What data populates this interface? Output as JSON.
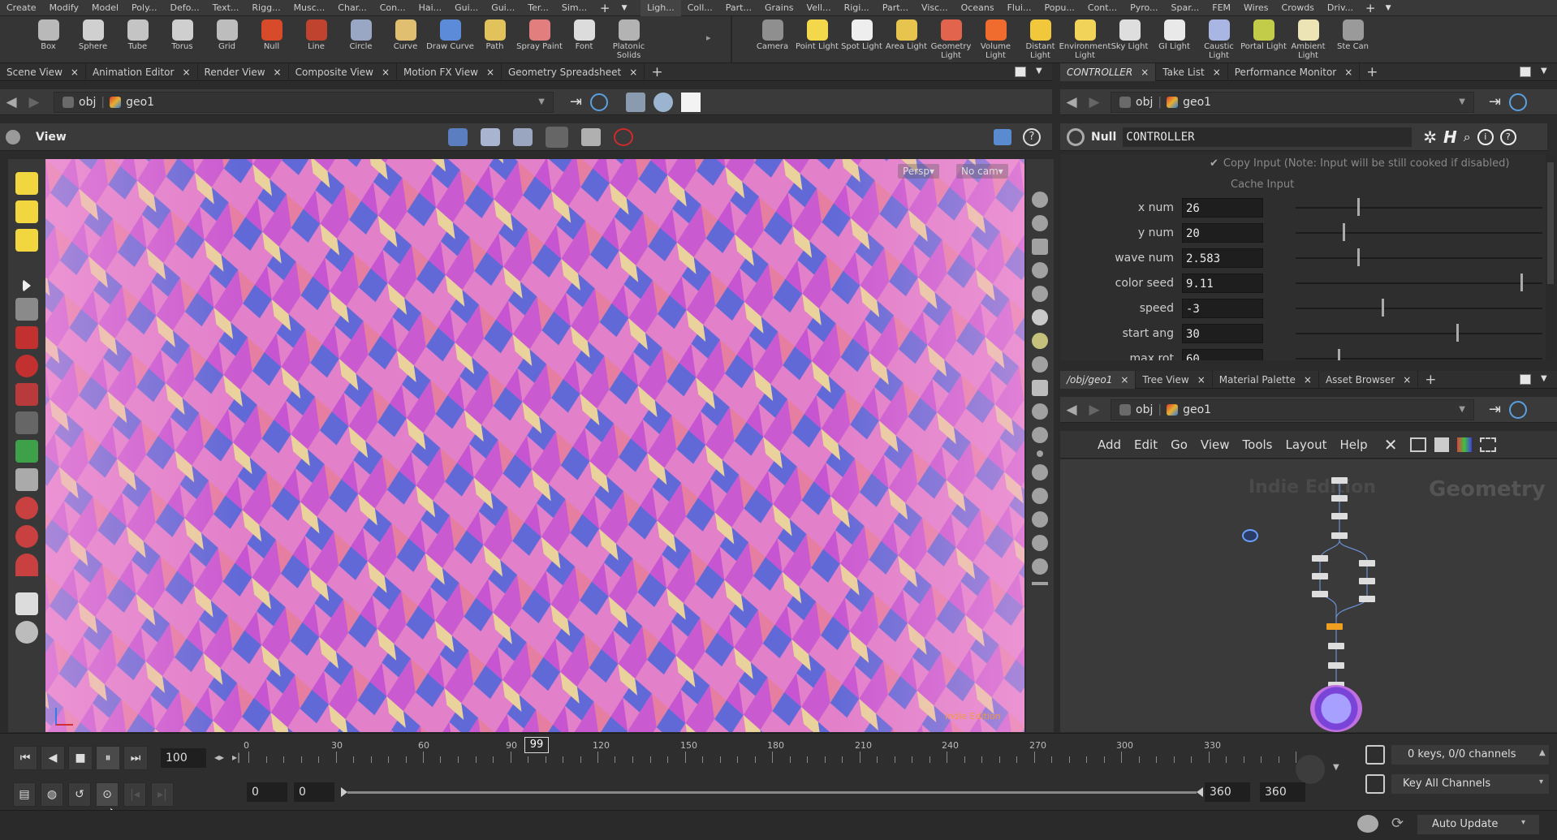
{
  "menubar": {
    "left_items": [
      "Create",
      "Modify",
      "Model",
      "Poly...",
      "Defo...",
      "Text...",
      "Rigg...",
      "Musc...",
      "Char...",
      "Con...",
      "Hai...",
      "Gui...",
      "Gui...",
      "Ter...",
      "Sim..."
    ],
    "right_items": [
      "Ligh...",
      "Coll...",
      "Part...",
      "Grains",
      "Vell...",
      "Rigi...",
      "Part...",
      "Visc...",
      "Oceans",
      "Flui...",
      "Popu...",
      "Cont...",
      "Pyro...",
      "Spar...",
      "FEM",
      "Wires",
      "Crowds",
      "Driv..."
    ]
  },
  "shelf": {
    "left_tools": [
      {
        "label": "Box",
        "color": "#b9b9b9"
      },
      {
        "label": "Sphere",
        "color": "#d0d0d0"
      },
      {
        "label": "Tube",
        "color": "#c4c4c4"
      },
      {
        "label": "Torus",
        "color": "#cfcfcf"
      },
      {
        "label": "Grid",
        "color": "#bdbdbd"
      },
      {
        "label": "Null",
        "color": "#d74a2a"
      },
      {
        "label": "Line",
        "color": "#c0432f"
      },
      {
        "label": "Circle",
        "color": "#9aa7c4"
      },
      {
        "label": "Curve",
        "color": "#e0c070"
      },
      {
        "label": "Draw Curve",
        "color": "#5b8bd9"
      },
      {
        "label": "Path",
        "color": "#e2c25a"
      },
      {
        "label": "Spray Paint",
        "color": "#e37e7e"
      },
      {
        "label": "Font",
        "color": "#dcdcdc"
      },
      {
        "label": "Platonic Solids",
        "color": "#b3b3b3"
      }
    ],
    "right_tools": [
      {
        "label": "Camera",
        "color": "#8f8f8f"
      },
      {
        "label": "Point Light",
        "color": "#f2d84a"
      },
      {
        "label": "Spot Light",
        "color": "#eeeeee"
      },
      {
        "label": "Area Light",
        "color": "#e7c44d"
      },
      {
        "label": "Geometry Light",
        "color": "#e2644d"
      },
      {
        "label": "Volume Light",
        "color": "#f06b2e"
      },
      {
        "label": "Distant Light",
        "color": "#f1c83c"
      },
      {
        "label": "Environment Light",
        "color": "#f1d35a"
      },
      {
        "label": "Sky Light",
        "color": "#dedede"
      },
      {
        "label": "GI Light",
        "color": "#e9e9e9"
      },
      {
        "label": "Caustic Light",
        "color": "#a9b6e4"
      },
      {
        "label": "Portal Light",
        "color": "#c3cc48"
      },
      {
        "label": "Ambient Light",
        "color": "#ece4b4"
      },
      {
        "label": "Ste Can",
        "color": "#9a9a9a"
      }
    ]
  },
  "scene_panel": {
    "tabs": [
      "Scene View",
      "Animation Editor",
      "Render View",
      "Composite View",
      "Motion FX View",
      "Geometry Spreadsheet"
    ],
    "path": {
      "root": "obj",
      "node": "geo1"
    },
    "view_label": "View",
    "hud": {
      "persp": "Persp▾",
      "cam": "No cam▾"
    },
    "watermark": "Indie Edition",
    "colors": {
      "pink": "#e07cc8",
      "magenta": "#c24bd0",
      "blue": "#4f62d6",
      "cream": "#e9d795",
      "salmon": "#e57a9c"
    }
  },
  "params_panel": {
    "tabs": [
      "CONTROLLER",
      "Take List",
      "Performance Monitor"
    ],
    "path": {
      "root": "obj",
      "node": "geo1"
    },
    "node_type": "Null",
    "node_name": "CONTROLLER",
    "copy_input": "Copy Input (Note: Input will be still cooked if disabled)",
    "cache_input": "Cache Input",
    "params": [
      {
        "label": "x num",
        "value": "26",
        "slider": 0.25
      },
      {
        "label": "y num",
        "value": "20",
        "slider": 0.19
      },
      {
        "label": "wave num",
        "value": "2.583",
        "slider": 0.25
      },
      {
        "label": "color seed",
        "value": "9.11",
        "slider": 0.91
      },
      {
        "label": "speed",
        "value": "-3",
        "slider": 0.35
      },
      {
        "label": "start ang",
        "value": "30",
        "slider": 0.65
      },
      {
        "label": "max rot",
        "value": "60",
        "slider": 0.17
      }
    ]
  },
  "network_panel": {
    "tabs": [
      "/obj/geo1",
      "Tree View",
      "Material Palette",
      "Asset Browser"
    ],
    "path": {
      "root": "obj",
      "node": "geo1"
    },
    "menu": [
      "Add",
      "Edit",
      "Go",
      "View",
      "Tools",
      "Layout",
      "Help"
    ],
    "watermark": "Indie Edition",
    "context_label": "Geometry"
  },
  "timeline": {
    "current_frame_display": "100",
    "cursor_frame": "99",
    "ticks": [
      "0",
      "30",
      "60",
      "90",
      "120",
      "150",
      "180",
      "210",
      "240",
      "270",
      "300",
      "330"
    ],
    "range_start": "0",
    "range_start2": "0",
    "range_end": "360",
    "range_end2": "360",
    "keys_status": "0 keys, 0/0 channels",
    "key_all": "Key All Channels",
    "auto_update": "Auto Update"
  }
}
